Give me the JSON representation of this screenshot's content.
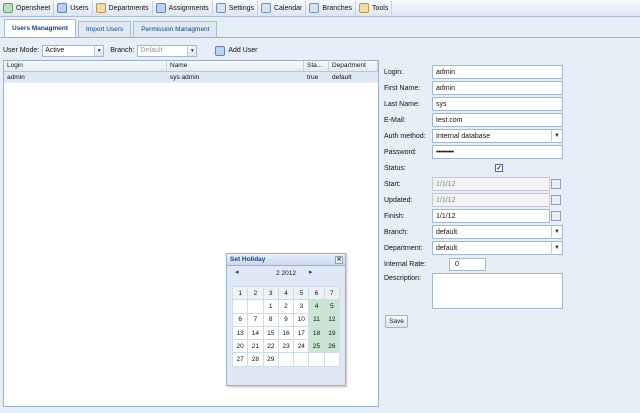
{
  "menu": [
    {
      "label": "Opensheet",
      "icon": "clock-icon"
    },
    {
      "label": "Users",
      "icon": "users-icon"
    },
    {
      "label": "Departments",
      "icon": "departments-icon"
    },
    {
      "label": "Assignments",
      "icon": "assignments-icon"
    },
    {
      "label": "Settings",
      "icon": "settings-icon"
    },
    {
      "label": "Calendar",
      "icon": "calendar-icon"
    },
    {
      "label": "Branches",
      "icon": "branches-icon"
    },
    {
      "label": "Tools",
      "icon": "tools-icon"
    }
  ],
  "tabs": [
    "Users Managment",
    "Import Users",
    "Permission Managment"
  ],
  "toolbar": {
    "user_mode_label": "User Mode:",
    "user_mode_value": "Active",
    "branch_label": "Branch:",
    "branch_placeholder": "Default",
    "add_user_label": "Add User"
  },
  "grid": {
    "columns": [
      "Login",
      "Name",
      "Sta...",
      "Department"
    ],
    "rows": [
      {
        "login": "admin",
        "name": "sys admin",
        "status": "true",
        "department": "default"
      }
    ]
  },
  "form": {
    "login_label": "Login:",
    "login_value": "admin",
    "first_name_label": "First Name:",
    "first_name_value": "admin",
    "last_name_label": "Last Name:",
    "last_name_value": "sys",
    "email_label": "E-Mail:",
    "email_value": "test.com",
    "auth_label": "Auth method:",
    "auth_value": "Internal database",
    "password_label": "Password:",
    "password_value": "•••••••••",
    "status_label": "Status:",
    "start_label": "Start:",
    "start_value": "1/1/12",
    "updated_label": "Updated:",
    "updated_value": "1/1/12",
    "finish_label": "Finish:",
    "finish_value": "1/1/12",
    "branch_label": "Branch:",
    "branch_value": "default",
    "department_label": "Department:",
    "department_value": "default",
    "internal_rate_label": "Internal Rate:",
    "internal_rate_value": "0",
    "description_label": "Description:",
    "save_label": "Save"
  },
  "calendar": {
    "title": "Set Holiday",
    "month_label": "2 2012",
    "weekday_headers": [
      "1",
      "2",
      "3",
      "4",
      "5",
      "6",
      "7"
    ],
    "weeks": [
      [
        "",
        "1",
        "2",
        "3",
        "4",
        "5"
      ],
      [
        "6",
        "7",
        "8",
        "9",
        "10",
        "11",
        "12"
      ],
      [
        "13",
        "14",
        "15",
        "16",
        "17",
        "18",
        "19"
      ],
      [
        "20",
        "21",
        "22",
        "23",
        "24",
        "25",
        "26"
      ],
      [
        "27",
        "28",
        "29",
        "",
        "",
        "",
        ""
      ]
    ]
  }
}
